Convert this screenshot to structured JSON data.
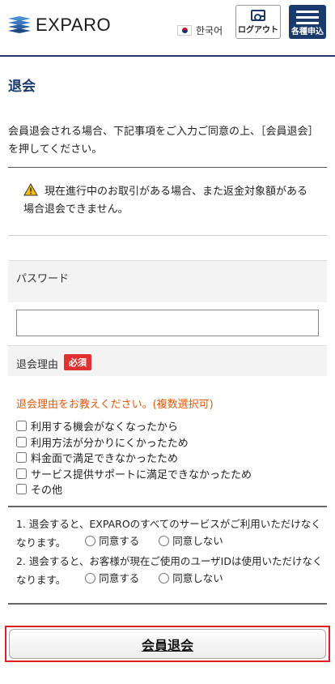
{
  "header": {
    "logo_text": "EXPARO",
    "language_label": "한국어",
    "logout_label": "ログアウト",
    "menu_label": "各種申込"
  },
  "page": {
    "title": "退会",
    "intro": "会員退会される場合、下記事項をご入力ご同意の上、［会員退会］を押してください。",
    "notice": "現在進行中のお取引がある場合、また返金対象額がある場合退会できません。"
  },
  "form": {
    "password_label": "パスワード",
    "password_value": "",
    "reason_label": "退会理由",
    "required_badge": "必須",
    "reason_hint": "退会理由をお教えください。(複数選択可)",
    "reasons": [
      "利用する機会がなくなったから",
      "利用方法が分かりにくかったため",
      "料金面で満足できなかったため",
      "サービス提供サポートに満足できなかったため",
      "その他"
    ],
    "agreements": [
      {
        "text": "1. 退会すると、EXPAROのすべてのサービスがご利用いただけなくなります。",
        "agree": "同意する",
        "disagree": "同意しない"
      },
      {
        "text": "2. 退会すると、お客様が現在ご使用のユーザIDは使用いただけなくなります。",
        "agree": "同意する",
        "disagree": "同意しない"
      }
    ],
    "submit_label": "会員退会"
  },
  "colors": {
    "brand_navy": "#1b3a6b",
    "required_red": "#e03030",
    "hint_orange": "#e05a10",
    "highlight_red": "#e02020"
  }
}
